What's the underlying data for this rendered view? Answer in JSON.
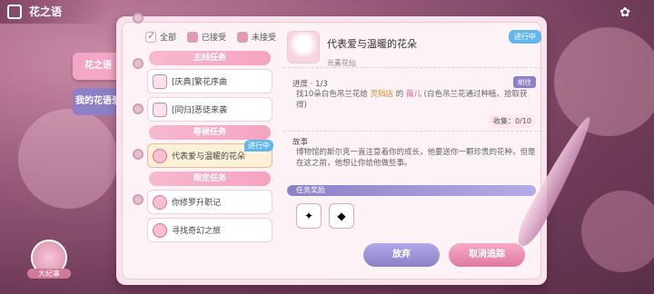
{
  "app": {
    "title": "花之语"
  },
  "side_tabs": {
    "active": "花之语",
    "inactive": "我的花语录"
  },
  "filters": [
    {
      "label": "全部",
      "state": "checked"
    },
    {
      "label": "已接受",
      "state": "filled"
    },
    {
      "label": "未接受",
      "state": "filled"
    }
  ],
  "sections": {
    "main": "主线任务",
    "wait": "等候任务",
    "limited": "限定任务"
  },
  "main_items": [
    {
      "label": "[庆典]繁花序曲"
    },
    {
      "label": "[同归]恶徒来袭"
    }
  ],
  "wait_items": [
    {
      "label": "代表爱与温暖的花朵",
      "badge": "进行中"
    }
  ],
  "limited_items": [
    {
      "label": "你修罗升职记"
    },
    {
      "label": "寻找奇幻之旅"
    }
  ],
  "detail": {
    "title": "代表爱与温暖的花朵",
    "subtitle": "元素花仙",
    "status": "进行中",
    "progress_label": "进度 · 1/3",
    "goto": "前往",
    "progress_text_a": "找10朵白色吊兰花给 ",
    "progress_place": "灵铛店",
    "progress_text_b": " 的 ",
    "progress_npc": "薇儿",
    "progress_text_c": " (白色吊兰花通过种植、拾取获得)",
    "collect": "收集：0/10",
    "story_label": "故事",
    "story_text": "博物馆的斯尔克一直注意着你的成长，他要送你一颗珍贵的花种，但是在这之前，他想让你给他做些事。",
    "reward_label": "任务奖励",
    "rewards": [
      "wand-icon",
      "gift-box-icon"
    ],
    "btn_abandon": "放弃",
    "btn_cancel": "取消追踪"
  },
  "chronicle": "大纪事"
}
